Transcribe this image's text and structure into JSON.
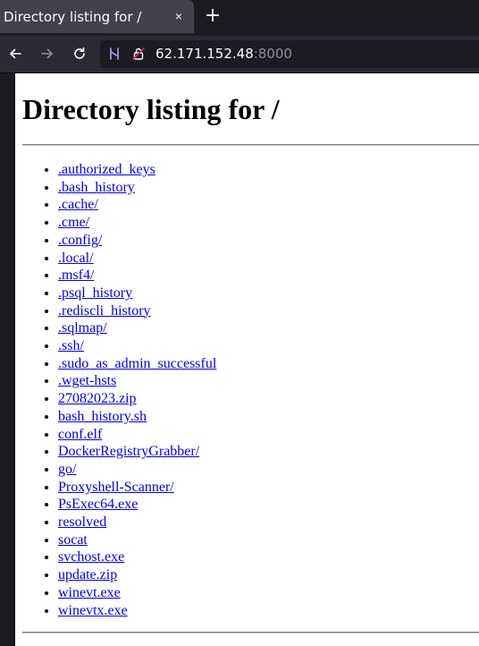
{
  "browser": {
    "tab": {
      "title": "Directory listing for /",
      "close_glyph": "×"
    },
    "new_tab_glyph": "+",
    "nav": {
      "back_icon": "arrow-left-icon",
      "forward_icon": "arrow-right-icon",
      "reload_icon": "reload-icon"
    },
    "url": {
      "host": "62.171.152.48",
      "port": ":8000"
    }
  },
  "page": {
    "heading": "Directory listing for /",
    "entries": [
      ".authorized_keys",
      ".bash_history",
      ".cache/",
      ".cme/",
      ".config/",
      ".local/",
      ".msf4/",
      ".psql_history",
      ".rediscli_history",
      ".sqlmap/",
      ".ssh/",
      ".sudo_as_admin_successful",
      ".wget-hsts",
      "27082023.zip",
      "bash_history.sh",
      "conf.elf",
      "DockerRegistryGrabber/",
      "go/",
      "Proxyshell-Scanner/",
      "PsExec64.exe",
      "resolved",
      "socat",
      "svchost.exe",
      "update.zip",
      "winevt.exe",
      "winevtx.exe"
    ]
  },
  "colors": {
    "link": "#0000ee",
    "chrome_dark": "#1c1b22",
    "toolbar": "#2b2a33",
    "active_tab": "#42414d"
  }
}
